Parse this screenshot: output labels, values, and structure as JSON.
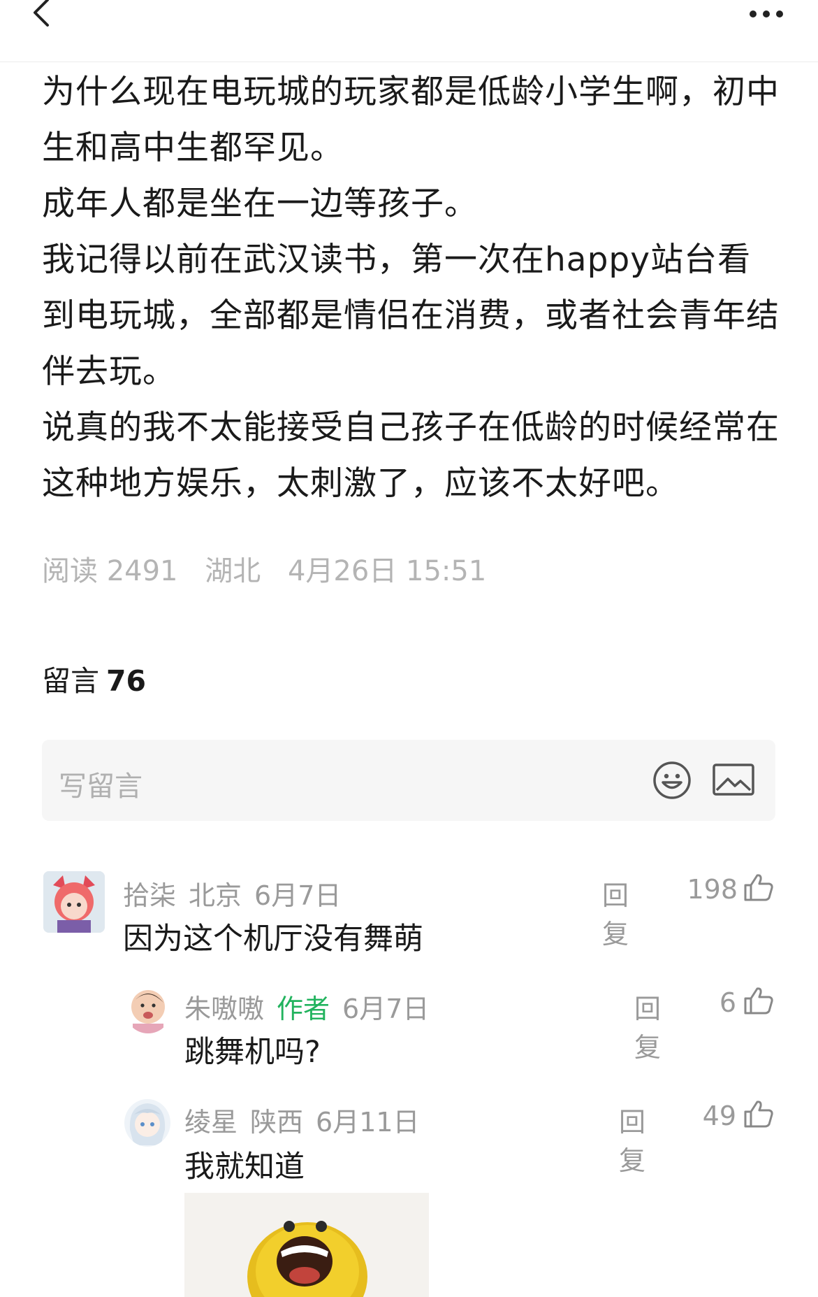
{
  "article": {
    "paragraphs": [
      "为什么现在电玩城的玩家都是低龄小学生啊，初中生和高中生都罕见。",
      "成年人都是坐在一边等孩子。",
      "我记得以前在武汉读书，第一次在happy站台看到电玩城，全部都是情侣在消费，或者社会青年结伴去玩。",
      "说真的我不太能接受自己孩子在低龄的时候经常在这种地方娱乐，太刺激了，应该不太好吧。"
    ],
    "meta": {
      "reads": "阅读 2491",
      "location": "湖北",
      "datetime": "4月26日 15:51"
    }
  },
  "comments_section": {
    "title_label": "留言",
    "count": "76",
    "compose_placeholder": "写留言"
  },
  "icons": {
    "back": "chevron-left-icon",
    "more": "ellipsis-icon",
    "emoji": "smiley-icon",
    "image": "image-icon",
    "like": "thumbs-up-icon"
  },
  "colors": {
    "author_tag": "#22b35e",
    "meta_text": "#b4b4b4"
  },
  "comments": [
    {
      "name": "拾柒",
      "location": "北京",
      "date": "6月7日",
      "reply": "回复",
      "likes": "198",
      "text": "因为这个机厅没有舞萌"
    },
    {
      "name": "朱嗷嗷",
      "tag": "作者",
      "date": "6月7日",
      "reply": "回复",
      "likes": "6",
      "text": "跳舞机吗?"
    },
    {
      "name": "绫星",
      "location": "陕西",
      "date": "6月11日",
      "reply": "回复",
      "likes": "49",
      "text": "我就知道"
    }
  ]
}
